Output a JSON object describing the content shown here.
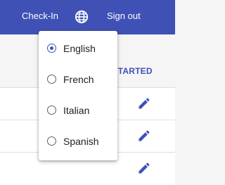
{
  "header": {
    "checkin_label": "Check-In",
    "signout_label": "Sign out",
    "globe_icon": "globe-icon"
  },
  "content": {
    "get_started_label": "Y STARTED"
  },
  "language_menu": {
    "selected": "English",
    "options": [
      {
        "label": "English",
        "checked": true
      },
      {
        "label": "French",
        "checked": false
      },
      {
        "label": "Italian",
        "checked": false
      },
      {
        "label": "Spanish",
        "checked": false
      }
    ]
  },
  "colors": {
    "primary": "#3f51b5",
    "background": "#f5f5f5",
    "menu_bg": "#ffffff"
  }
}
